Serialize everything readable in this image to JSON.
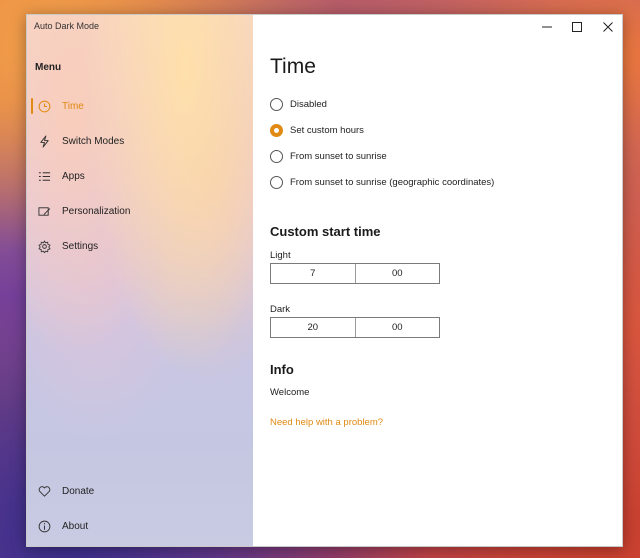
{
  "window": {
    "title": "Auto Dark Mode"
  },
  "sidebar": {
    "menu_title": "Menu",
    "items": [
      {
        "label": "Time",
        "icon": "clock-icon",
        "active": true
      },
      {
        "label": "Switch Modes",
        "icon": "lightning-icon"
      },
      {
        "label": "Apps",
        "icon": "list-icon"
      },
      {
        "label": "Personalization",
        "icon": "paint-icon"
      },
      {
        "label": "Settings",
        "icon": "gear-icon"
      }
    ],
    "footer": [
      {
        "label": "Donate",
        "icon": "heart-icon"
      },
      {
        "label": "About",
        "icon": "info-icon"
      }
    ]
  },
  "main": {
    "title": "Time",
    "mode_options": [
      {
        "label": "Disabled",
        "checked": false
      },
      {
        "label": "Set custom hours",
        "checked": true
      },
      {
        "label": "From sunset to sunrise",
        "checked": false
      },
      {
        "label": "From sunset to sunrise (geographic coordinates)",
        "checked": false
      }
    ],
    "custom_start": {
      "title": "Custom start time",
      "light": {
        "label": "Light",
        "hour": "7",
        "minute": "00"
      },
      "dark": {
        "label": "Dark",
        "hour": "20",
        "minute": "00"
      }
    },
    "info": {
      "title": "Info",
      "text": "Welcome",
      "help_link": "Need help with a problem?"
    }
  },
  "colors": {
    "accent": "#e08a13"
  }
}
